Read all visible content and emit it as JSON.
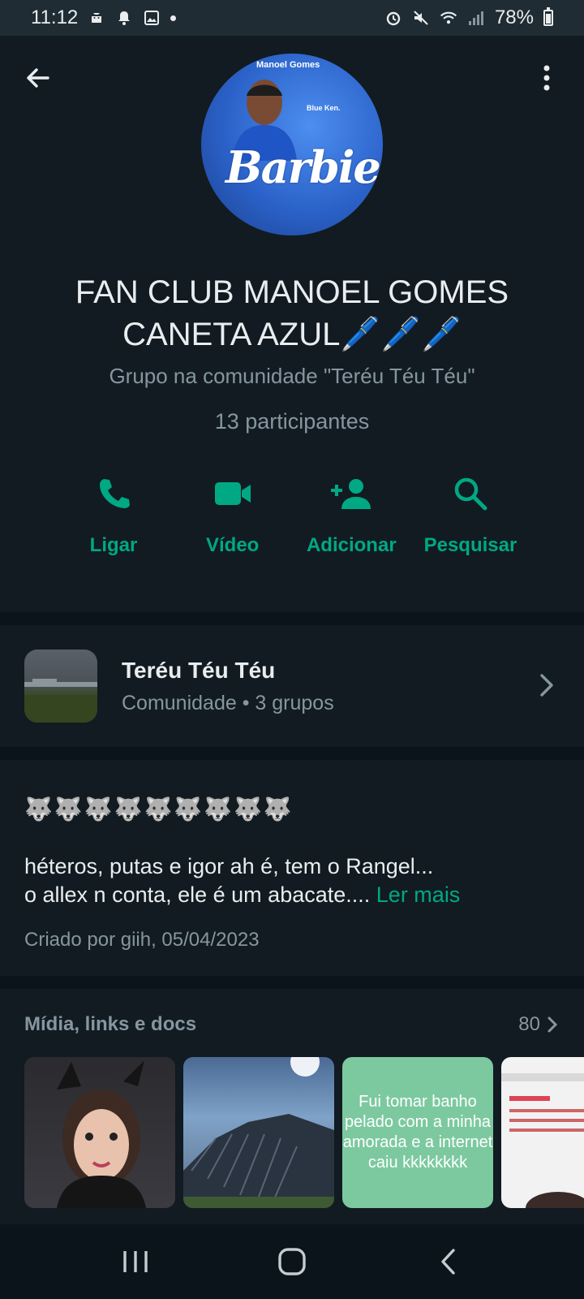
{
  "status_bar": {
    "time": "11:12",
    "battery": "78%",
    "icons": [
      "android-icon",
      "bell-icon",
      "image-icon",
      "dot-icon",
      "alarm-icon",
      "mute-icon",
      "wifi-icon",
      "signal-icon",
      "battery-icon"
    ]
  },
  "header": {
    "title": "FAN CLUB MANOEL GOMES CANETA AZUL🖊️🖊️🖊️",
    "subtitle": "Grupo na comunidade \"Teréu Téu Téu\"",
    "participants": "13 participantes",
    "avatar_text": {
      "top": "Manoel Gomes",
      "mid": "Blue Ken.",
      "brand": "Barbie"
    }
  },
  "actions": [
    {
      "label": "Ligar",
      "icon": "phone-icon"
    },
    {
      "label": "Vídeo",
      "icon": "video-icon"
    },
    {
      "label": "Adicionar",
      "icon": "add-person-icon"
    },
    {
      "label": "Pesquisar",
      "icon": "search-icon"
    }
  ],
  "community": {
    "name": "Teréu Téu Téu",
    "meta": "Comunidade • 3 grupos"
  },
  "description": {
    "emojis": "🐺🐺🐺🐺🐺🐺🐺🐺🐺",
    "line1": "héteros, putas e igor ah é, tem o Rangel...",
    "line2": "o allex n conta, ele é um abacate....",
    "more": "Ler mais",
    "created": "Criado por giih, 05/04/2023"
  },
  "media": {
    "title": "Mídia, links e docs",
    "count": "80",
    "text_thumb": "Fui tomar banho\npelado com a minha\namorada e a internet\ncaiu kkkkkkkk"
  },
  "colors": {
    "accent": "#00a884",
    "background": "#111b21",
    "secondary_text": "#8696a0"
  }
}
